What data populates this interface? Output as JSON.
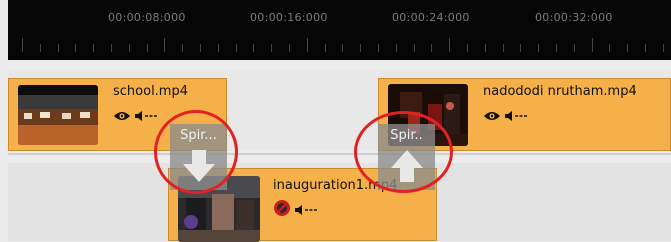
{
  "ruler": {
    "timecodes": [
      "00:00:08:000",
      "00:00:16:000",
      "00:00:24:000",
      "00:00:32:000"
    ]
  },
  "clips": {
    "school": {
      "name": "school.mp4"
    },
    "nadododi": {
      "name": "nadododi nrutham.mp4"
    },
    "inauguration": {
      "name": "inauguration1.mp4"
    }
  },
  "dropzones": {
    "below": {
      "label": "Spir..."
    },
    "above": {
      "label": "Spir.."
    }
  },
  "colors": {
    "clip": "#f6b04a",
    "highlight": "#e02222",
    "ruler_bg": "#060606"
  },
  "icons": {
    "visible": "eye-icon",
    "audio": "speaker-icon",
    "hidden": "no-entry-icon",
    "drop_down": "arrow-down-icon",
    "drop_up": "arrow-up-icon"
  }
}
